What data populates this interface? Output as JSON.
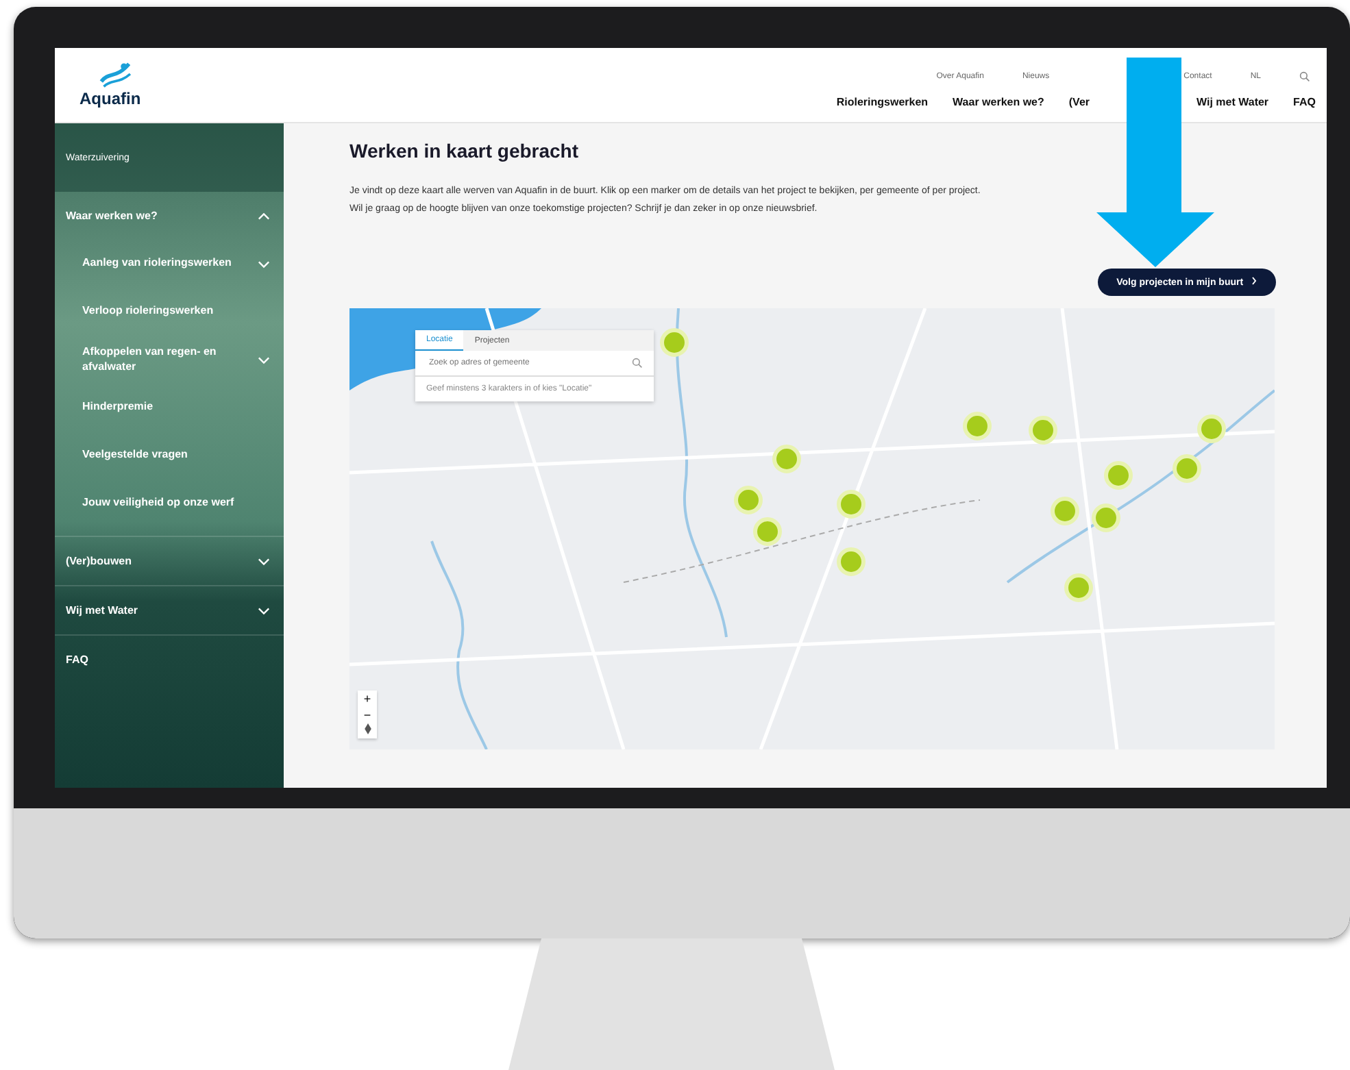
{
  "header": {
    "logo": "Aquafin",
    "utility_links": [
      "Over Aquafin",
      "Nieuws",
      "Contact",
      "NL"
    ],
    "nav": [
      "Rioleringswerken",
      "Waar werken we?",
      "(Ver",
      "Wij met Water",
      "FAQ"
    ]
  },
  "sidebar": {
    "items": [
      {
        "label": "Waterzuivering",
        "kind": "link"
      },
      {
        "label": "Waar werken we?",
        "kind": "toggle",
        "expanded": true,
        "children": [
          {
            "label": "Aanleg van rioleringswerken",
            "kind": "toggle",
            "expanded": false
          },
          {
            "label": "Verloop rioleringswerken",
            "kind": "link"
          },
          {
            "label": "Afkoppelen van regen- en afvalwater",
            "kind": "toggle",
            "expanded": false
          },
          {
            "label": "Hinderpremie",
            "kind": "link"
          },
          {
            "label": "Veelgestelde vragen",
            "kind": "link"
          },
          {
            "label": "Jouw veiligheid op onze werf",
            "kind": "link"
          }
        ]
      },
      {
        "label": "(Ver)bouwen",
        "kind": "toggle",
        "expanded": false
      },
      {
        "label": "Wij met Water",
        "kind": "toggle",
        "expanded": false
      },
      {
        "label": "FAQ",
        "kind": "link"
      }
    ]
  },
  "content": {
    "title": "Werken in kaart gebracht",
    "intro": [
      "Je vindt op deze kaart alle werven van Aquafin in de buurt. Klik op een marker om de details van het project te bekijken, per gemeente of per project.",
      "Wil je graag op de hoogte blijven van onze toekomstige projecten? Schrijf je dan zeker in op onze nieuwsbrief."
    ],
    "button": "Volg projecten in mijn buurt",
    "map": {
      "tabs": [
        {
          "label": "Locatie",
          "selected": true
        },
        {
          "label": "Projecten",
          "selected": false
        }
      ],
      "search": {
        "placeholder": "Zoek op adres of gemeente"
      },
      "hint": "Geef minstens 3 karakters in of kies \"Locatie\"",
      "zoom": [
        "+",
        "−"
      ]
    }
  }
}
